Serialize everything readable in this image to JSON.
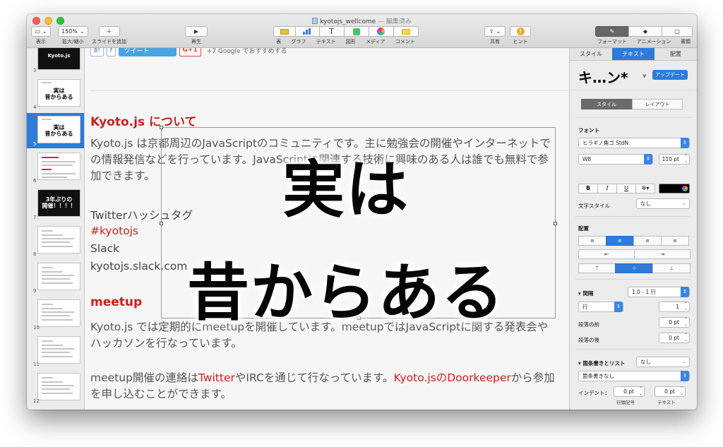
{
  "window": {
    "title": "kyotojs_wellcome",
    "status": "— 編集済み"
  },
  "toolbar": {
    "view": "表示",
    "zoom_value": "150%",
    "zoom": "拡大/縮小",
    "add_slide": "スライドを追加",
    "play": "再生",
    "table": "表",
    "chart": "グラフ",
    "text": "テキスト",
    "shape": "図形",
    "media": "メディア",
    "comment": "コメント",
    "share": "共有",
    "hint": "ヒント",
    "format": "フォーマット",
    "animate": "アニメーション",
    "document": "書類"
  },
  "navigator": {
    "slides": [
      {
        "num": "3",
        "label": "Kyoto.js",
        "kind": "black-top"
      },
      {
        "num": "4",
        "label": "実は\n昔からある",
        "kind": "white-big"
      },
      {
        "num": "5",
        "label": "実は\n昔からある",
        "kind": "white-big",
        "selected": true
      },
      {
        "num": "6",
        "label": "",
        "kind": "white-red"
      },
      {
        "num": "7",
        "label": "3年ぶりの\n開催！！！！",
        "kind": "black"
      },
      {
        "num": "8",
        "label": "",
        "kind": "white-lines"
      },
      {
        "num": "9",
        "label": "",
        "kind": "white-lines"
      },
      {
        "num": "10",
        "label": "",
        "kind": "white-lines"
      },
      {
        "num": "11",
        "label": "",
        "kind": "white-lines"
      },
      {
        "num": "12",
        "label": "",
        "kind": "white-lines"
      }
    ]
  },
  "slide": {
    "share_b": "B!",
    "share_f": "f",
    "tweet": "ツイート",
    "gplus": "G+1",
    "gplus_text": "+7  Google でおすすめする",
    "heading1": "Kyoto.js について",
    "para1": "Kyoto.js は京都周辺のJavaScriptのコミュニティです。主に勉強会の開催やインターネットでの情報発信などを行っています。JavaScriptに関連する技術に興味のある人は誰でも無料で参加できます。",
    "twitter_label": "Twitterハッシュタグ",
    "hashtag": "#kyotojs",
    "slack": "Slack",
    "slack_url": "kyotojs.slack.com",
    "heading2": "meetup",
    "para2": "Kyoto.js では定期的にmeetupを開催しています。meetupではJavaScriptに関する発表会やハッカソンを行なっています。",
    "para3_a": "meetup開催の連絡は",
    "para3_twitter": "Twitter",
    "para3_b": "やIRCを通じて行なっています。",
    "para3_door": "Kyoto.jsのDoorkeeper",
    "para3_c": "から参加を申し込むことができます。",
    "overlay_line1": "実は",
    "overlay_line2": "昔からある"
  },
  "inspector": {
    "tabs": [
      "スタイル",
      "テキスト",
      "配置"
    ],
    "active_tab": "テキスト",
    "para_style": "キ…ン*",
    "update": "アップデート",
    "sub_tabs": [
      "スタイル",
      "レイアウト"
    ],
    "font_label": "フォント",
    "font_family": "ヒラギノ角ゴ StdN",
    "font_weight": "W8",
    "font_size": "110 pt",
    "bold": "B",
    "italic": "I",
    "underline": "U",
    "gear": "✲▾",
    "char_style_label": "文字スタイル",
    "char_style": "なし",
    "align_label": "配置",
    "spacing_label": "間隔",
    "spacing_value": "1.0 - 1 行",
    "line_unit": "行",
    "line_value": "1",
    "before_label": "段落の前",
    "before_value": "0 pt",
    "after_label": "段落の後",
    "after_value": "0 pt",
    "bullets_label": "箇条書きとリスト",
    "bullets_value": "なし",
    "bullets_style": "箇条書きなし",
    "indent_label": "インデント：",
    "indent_bullet": "0 pt",
    "indent_text": "0 pt",
    "indent_bullet_caption": "行頭記号",
    "indent_text_caption": "テキスト"
  },
  "colors": {
    "accent": "#2f7bd9",
    "red_text": "#cc1f1f"
  }
}
